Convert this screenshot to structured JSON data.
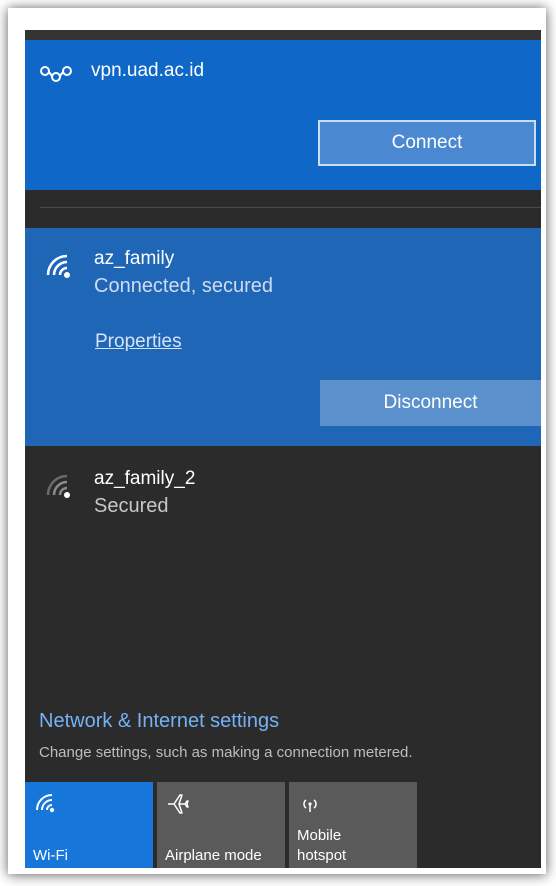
{
  "vpn": {
    "name": "vpn.uad.ac.id",
    "connect_label": "Connect",
    "icon": "vpn-icon"
  },
  "networks": [
    {
      "name": "az_family",
      "status": "Connected, secured",
      "properties_label": "Properties",
      "disconnect_label": "Disconnect",
      "icon": "wifi-signal-icon"
    },
    {
      "name": "az_family_2",
      "status": "Secured",
      "icon": "wifi-signal-icon"
    }
  ],
  "settings": {
    "title": "Network & Internet settings",
    "subtitle": "Change settings, such as making a connection metered."
  },
  "quick_actions": [
    {
      "label": "Wi-Fi",
      "icon": "wifi-icon",
      "active": true
    },
    {
      "label": "Airplane mode",
      "icon": "airplane-icon",
      "active": false
    },
    {
      "label": "Mobile hotspot",
      "icon": "hotspot-icon",
      "active": false
    }
  ],
  "colors": {
    "accent": "#0f67c7",
    "connected_bg": "#1f66b7",
    "panel_bg": "#2b2b2b",
    "link": "#74b2f5"
  }
}
